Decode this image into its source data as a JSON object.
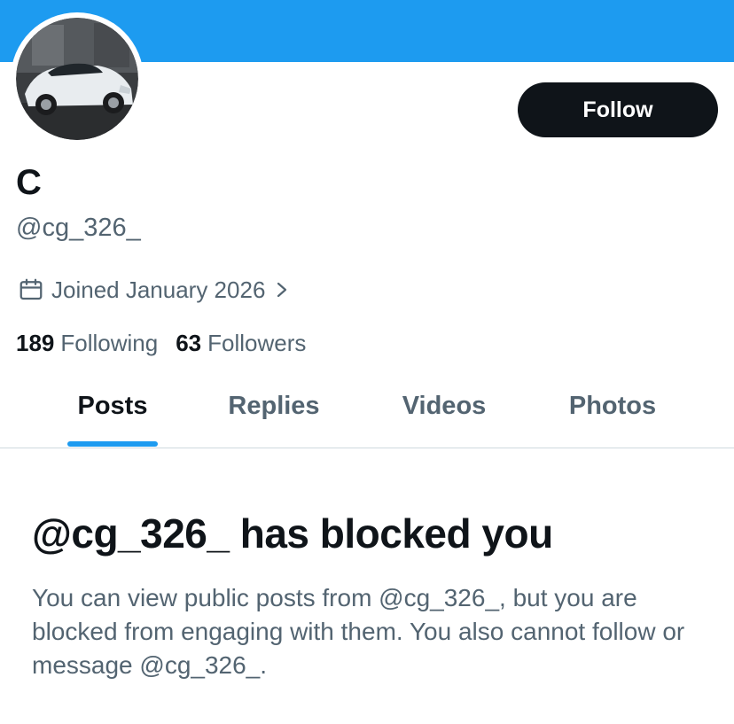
{
  "profile": {
    "display_name": "C",
    "handle": "@cg_326_",
    "joined": "Joined January 2026",
    "following_count": "189",
    "following_label": "Following",
    "followers_count": "63",
    "followers_label": "Followers",
    "avatar": "porsche-918-car-photo"
  },
  "actions": {
    "follow_label": "Follow"
  },
  "tabs": [
    {
      "label": "Posts",
      "active": true
    },
    {
      "label": "Replies",
      "active": false
    },
    {
      "label": "Videos",
      "active": false
    },
    {
      "label": "Photos",
      "active": false
    }
  ],
  "blocked": {
    "title": "@cg_326_ has blocked you",
    "message": "You can view public posts from @cg_326_, but you are blocked from engaging with them. You also cannot follow or message @cg_326_."
  },
  "colors": {
    "banner": "#1d9bf0",
    "accent": "#1d9bf0",
    "text_primary": "#0f1419",
    "text_secondary": "#536471"
  },
  "icons": {
    "joined": "calendar-icon",
    "joined_chevron": "chevron-right-icon"
  }
}
